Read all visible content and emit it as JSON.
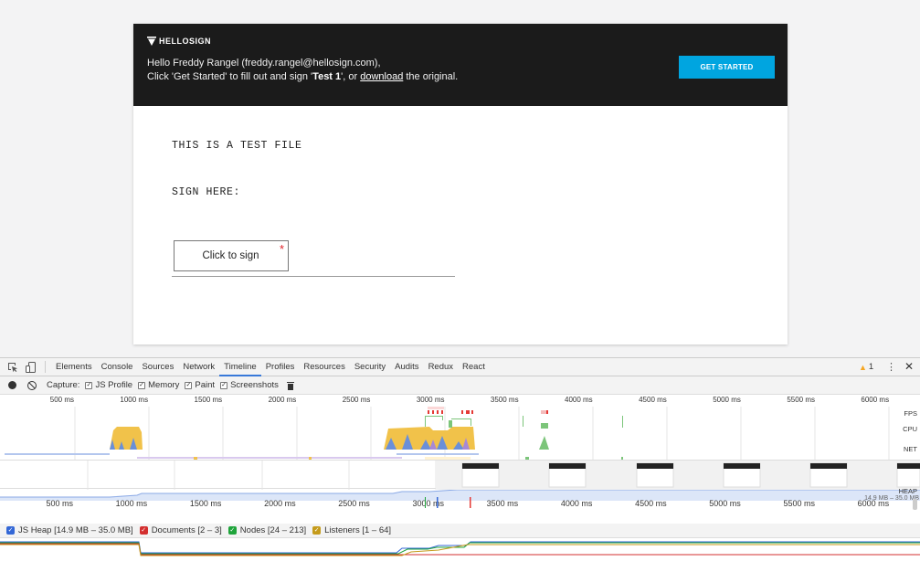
{
  "document": {
    "brand": "HELLOSIGN",
    "greeting_line": "Hello Freddy Rangel (freddy.rangel@hellosign.com),",
    "instruction_prefix": "Click 'Get Started' to fill out and sign '",
    "doc_name": "Test 1",
    "instruction_mid": "', or ",
    "download_link": "download",
    "instruction_suffix": " the original.",
    "cta_label": "GET STARTED",
    "body_line1": "THIS IS A TEST FILE",
    "body_line2": "SIGN HERE:",
    "sign_field_label": "Click to sign",
    "required_mark": "*",
    "colors": {
      "banner": "#1b1b1b",
      "cta": "#00a5e0",
      "required": "#e0242a"
    }
  },
  "devtools": {
    "tabs": [
      "Elements",
      "Console",
      "Sources",
      "Network",
      "Timeline",
      "Profiles",
      "Resources",
      "Security",
      "Audits",
      "Redux",
      "React"
    ],
    "active_tab": "Timeline",
    "warning_count": "1",
    "capture_label": "Capture:",
    "capture_options": [
      {
        "label": "JS Profile",
        "checked": true
      },
      {
        "label": "Memory",
        "checked": true
      },
      {
        "label": "Paint",
        "checked": true
      },
      {
        "label": "Screenshots",
        "checked": true
      }
    ],
    "ruler_ticks": [
      "500 ms",
      "1000 ms",
      "1500 ms",
      "2000 ms",
      "2500 ms",
      "3000 ms",
      "3500 ms",
      "4000 ms",
      "4500 ms",
      "5000 ms",
      "5500 ms",
      "6000 ms"
    ],
    "row_labels": {
      "fps": "FPS",
      "cpu": "CPU",
      "net": "NET",
      "heap": "HEAP"
    },
    "heap_range": "14.9 MB – 35.0 MB",
    "counters": [
      {
        "label": "JS Heap [14.9 MB – 35.0 MB]",
        "color": "#3367d6"
      },
      {
        "label": "Documents [2 – 3]",
        "color": "#d32f2f"
      },
      {
        "label": "Nodes [24 – 213]",
        "color": "#1fa43b"
      },
      {
        "label": "Listeners [1 – 64]",
        "color": "#c59b1b"
      }
    ]
  }
}
